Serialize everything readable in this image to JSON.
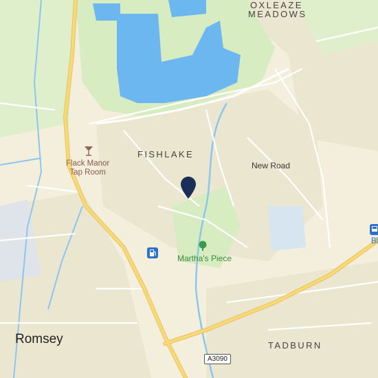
{
  "map": {
    "colors": {
      "land": "#f3efdc",
      "residential": "#ebe6cf",
      "water": "#a8d3f1",
      "lake": "#6cb7f0",
      "park": "#d7ecc0",
      "road_major": "#f7d978",
      "road_minor": "#ffffff",
      "pin": "#1a2f57"
    },
    "area_labels": {
      "oxleaze_1": "OXLEAZE",
      "oxleaze_2": "MEADOWS",
      "fishlake": "FISHLAKE",
      "tadburn": "TADBURN"
    },
    "town_label": "Romsey",
    "road_labels": {
      "new_road": "New Road"
    },
    "road_shield": "A3090",
    "pois": {
      "pub_line1": "Flack Manor",
      "pub_line2": "Tap Room",
      "park": "Martha's Piece",
      "edge_label": "Bl"
    },
    "icons": {
      "pub": "cocktail-glass-icon",
      "fuel": "fuel-pump-icon",
      "park": "tree-icon",
      "pin": "location-pin-icon",
      "edge": "bus-stop-icon"
    }
  }
}
